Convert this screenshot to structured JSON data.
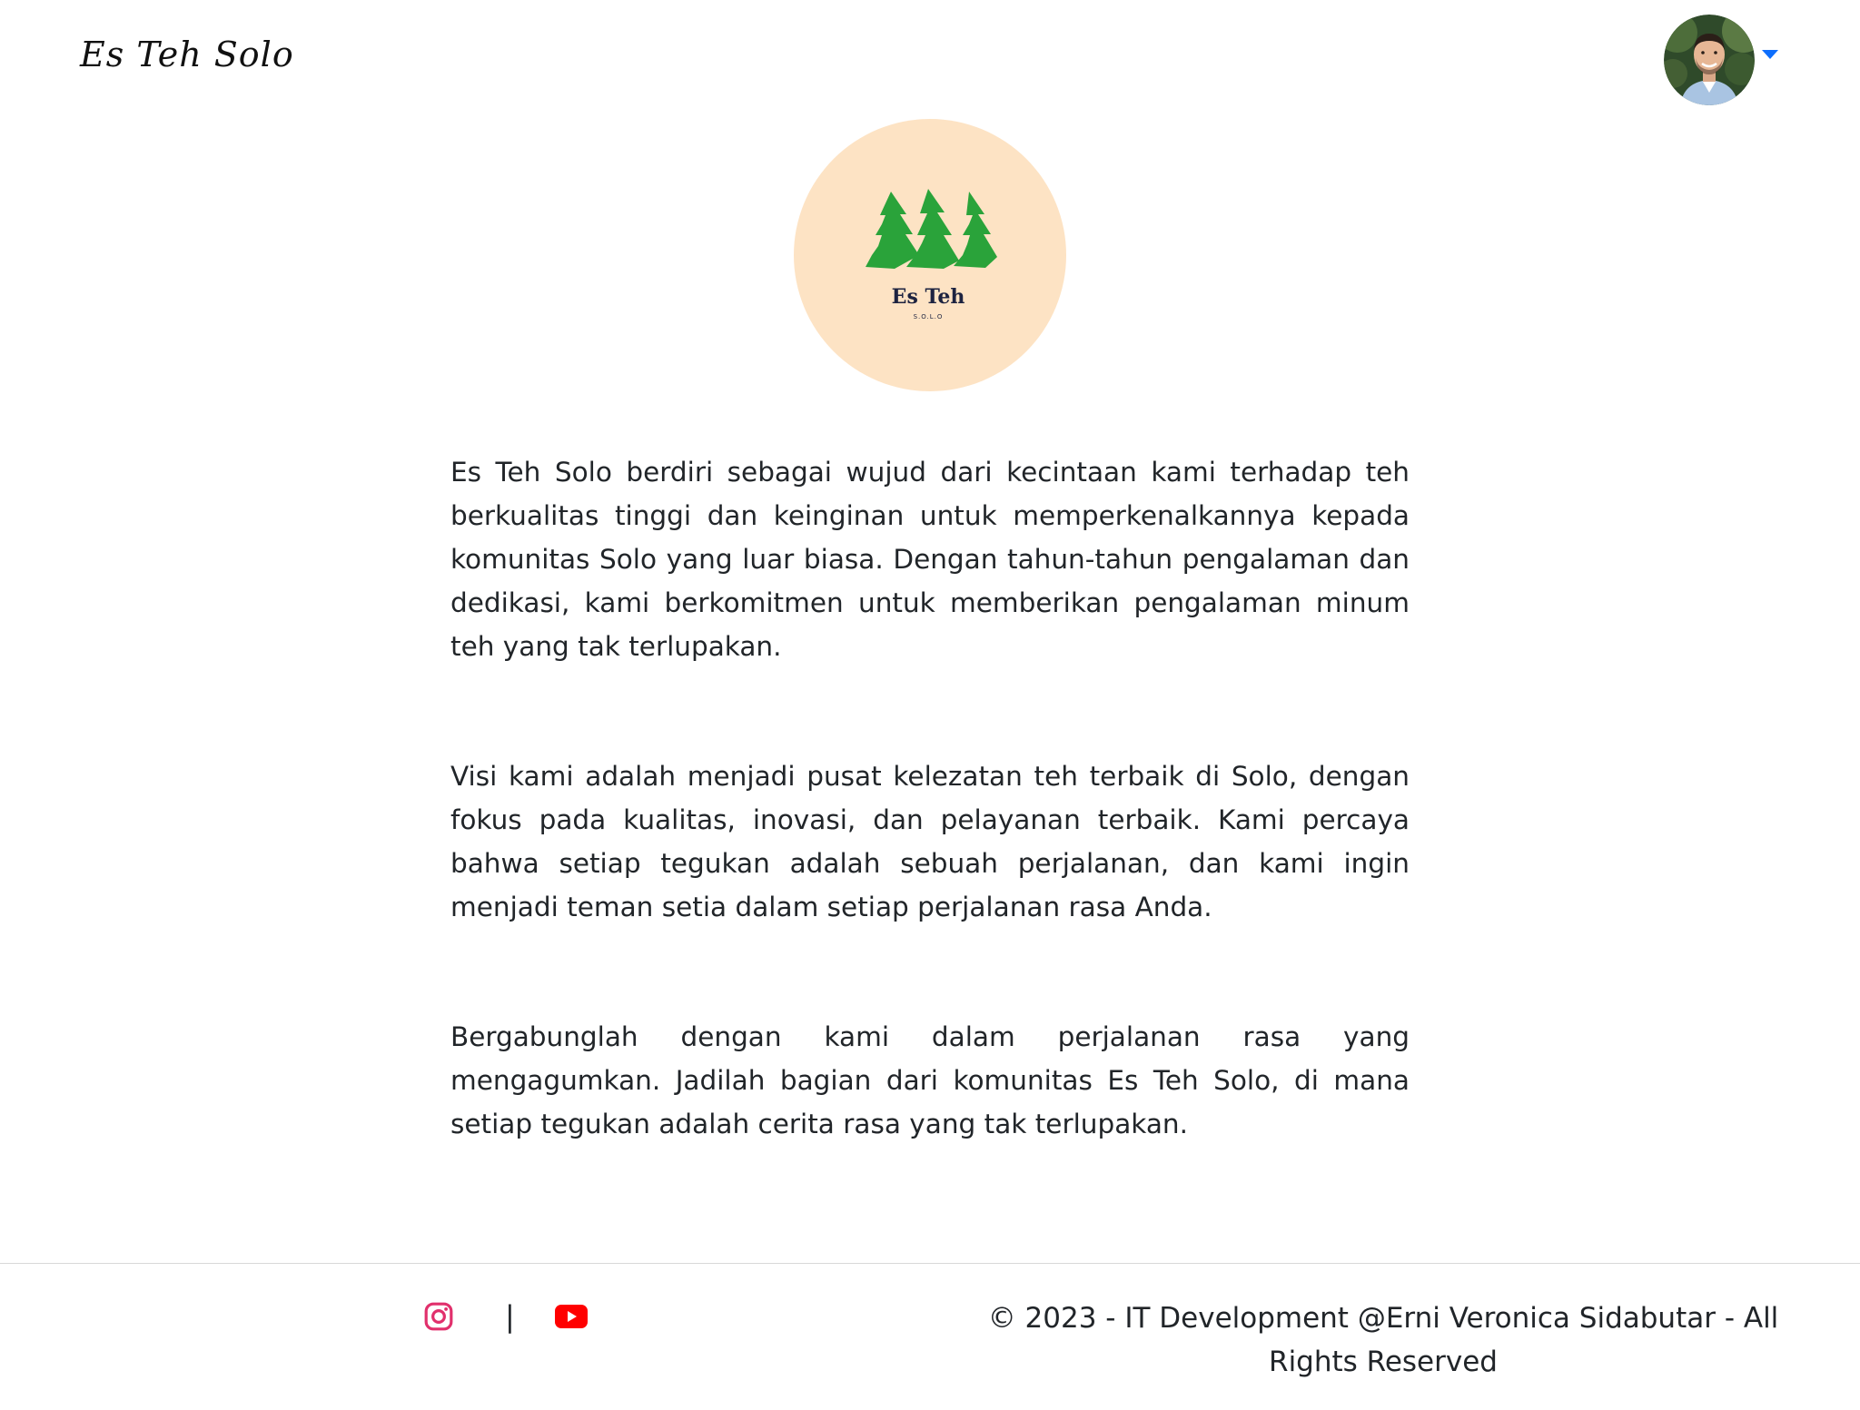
{
  "navbar": {
    "brand": "Es Teh Solo",
    "profile_icon": "user-avatar",
    "dropdown_icon": "caret-down-icon",
    "accent": "#0d6efd"
  },
  "logo": {
    "title": "Es Teh",
    "subtitle": "S.O.L.O",
    "background": "#fde3c4",
    "tree_color": "#2aa33a",
    "text_color": "#1d2340"
  },
  "about": {
    "paragraphs": [
      "Es Teh Solo berdiri sebagai wujud dari kecintaan kami terhadap teh berkualitas tinggi dan keinginan untuk memperkenalkannya kepada komunitas Solo yang luar biasa. Dengan tahun-tahun pengalaman dan dedikasi, kami berkomitmen untuk memberikan pengalaman minum teh yang tak terlupakan.",
      "Visi kami adalah menjadi pusat kelezatan teh terbaik di Solo, dengan fokus pada kualitas, inovasi, dan pelayanan terbaik. Kami percaya bahwa setiap tegukan adalah sebuah perjalanan, dan kami ingin menjadi teman setia dalam setiap perjalanan rasa Anda.",
      "Bergabunglah dengan kami dalam perjalanan rasa yang mengagumkan. Jadilah bagian dari komunitas Es Teh Solo, di mana setiap tegukan adalah cerita rasa yang tak terlupakan."
    ]
  },
  "footer": {
    "separator": "|",
    "instagram_icon": "instagram-icon",
    "youtube_icon": "youtube-icon",
    "instagram_color": "#e1306c",
    "youtube_color": "#ff0000",
    "copyright": "© 2023 - IT Development @Erni Veronica Sidabutar - All Rights Reserved"
  }
}
